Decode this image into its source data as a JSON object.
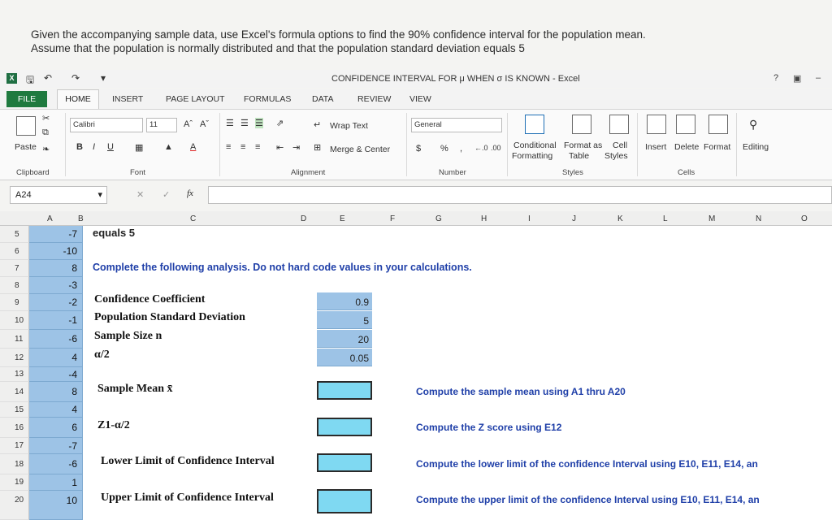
{
  "question": {
    "line1": "Given the accompanying sample data, use Excel's formula options to find the 90% confidence interval for the population mean.",
    "line2": "Assume that the population is normally distributed and that the population standard deviation equals 5"
  },
  "window": {
    "title": "CONFIDENCE INTERVAL FOR μ WHEN σ IS KNOWN - Excel",
    "help": "?",
    "minimize": "–"
  },
  "tabs": [
    "FILE",
    "HOME",
    "INSERT",
    "PAGE LAYOUT",
    "FORMULAS",
    "DATA",
    "REVIEW",
    "VIEW"
  ],
  "ribbon": {
    "paste": "Paste",
    "clipboard": "Clipboard",
    "font_name": "Calibri",
    "font_size": "11",
    "font_group": "Font",
    "wrap_text": "Wrap Text",
    "merge_center": "Merge & Center",
    "alignment_group": "Alignment",
    "number_format": "General",
    "currency": "$",
    "percent": "%",
    "comma": ",",
    "number_group": "Number",
    "conditional_formatting": [
      "Conditional",
      "Formatting"
    ],
    "format_as_table": [
      "Format as",
      "Table"
    ],
    "cell_styles": [
      "Cell",
      "Styles"
    ],
    "styles_group": "Styles",
    "insert": "Insert",
    "delete": "Delete",
    "format": "Format",
    "cells_group": "Cells",
    "editing": "Editing",
    "bold": "B",
    "italic": "I",
    "underline": "U"
  },
  "formula_bar": {
    "name_box": "A24",
    "cancel": "✕",
    "enter": "✓",
    "fx": "fx"
  },
  "columns": [
    "A",
    "B",
    "C",
    "D",
    "E",
    "F",
    "G",
    "H",
    "I",
    "J",
    "K",
    "L",
    "M",
    "N",
    "O"
  ],
  "rows": [
    {
      "num": "5",
      "a": "-7"
    },
    {
      "num": "6",
      "a": "-10"
    },
    {
      "num": "7",
      "a": "8"
    },
    {
      "num": "8",
      "a": "-3"
    },
    {
      "num": "9",
      "a": "-2"
    },
    {
      "num": "10",
      "a": "-1"
    },
    {
      "num": "11",
      "a": "-6"
    },
    {
      "num": "12",
      "a": "4"
    },
    {
      "num": "13",
      "a": "-4"
    },
    {
      "num": "14",
      "a": "8"
    },
    {
      "num": "15",
      "a": "4"
    },
    {
      "num": "16",
      "a": "6"
    },
    {
      "num": "17",
      "a": "-7"
    },
    {
      "num": "18",
      "a": "-6"
    },
    {
      "num": "19",
      "a": "1"
    },
    {
      "num": "20",
      "a": "10"
    }
  ],
  "sheet": {
    "b5": "equals 5",
    "b7": "Complete the following analysis. Do not hard code values in your calculations.",
    "labels": {
      "conf": "Confidence Coefficient",
      "sd": "Population Standard Deviation",
      "n": "Sample Size n",
      "alpha": "α/2",
      "mean": "Sample Mean x̄",
      "z": "Z1-α/2",
      "lower": "Lower Limit of Confidence Interval",
      "upper": "Upper Limit of Confidence Interval"
    },
    "values": {
      "conf": "0.9",
      "sd": "5",
      "n": "20",
      "alpha": "0.05"
    },
    "instructions": {
      "mean": "Compute the sample mean using A1 thru A20",
      "z": "Compute the Z score  using E12",
      "lower": "Compute the lower limit of the confidence Interval using E10, E11, E14, an",
      "upper": "Compute the upper limit of the confidence Interval using E10, E11, E14, an"
    }
  }
}
